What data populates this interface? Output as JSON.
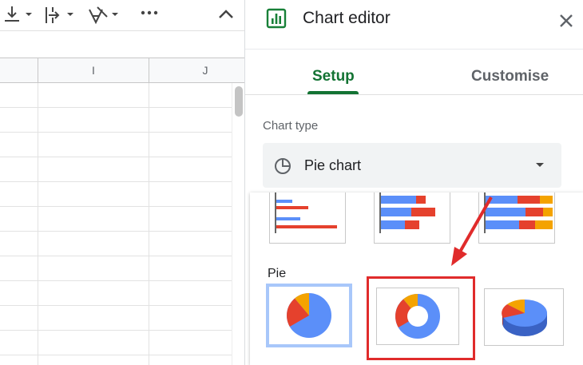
{
  "sheet": {
    "columns": [
      {
        "label": ""
      },
      {
        "label": "I"
      },
      {
        "label": "J"
      }
    ],
    "toolbar_icons": [
      "vertical-align-icon",
      "text-wrap-icon",
      "text-rotation-icon",
      "more-icon",
      "collapse-icon"
    ]
  },
  "editor": {
    "title": "Chart editor",
    "tabs": [
      {
        "label": "Setup",
        "active": true
      },
      {
        "label": "Customise",
        "active": false
      }
    ],
    "chart_type_label": "Chart type",
    "selected_chart_type": "Pie chart",
    "dropdown": {
      "section_title": "Pie",
      "pie_options": [
        {
          "name": "Pie chart",
          "selected": true
        },
        {
          "name": "Doughnut chart",
          "selected": false,
          "highlighted": true
        },
        {
          "name": "3D pie chart",
          "selected": false
        }
      ]
    }
  },
  "colors": {
    "accent_green": "#137333",
    "blue": "#5b8ff9",
    "red": "#e5412d",
    "orange": "#f4a300",
    "highlight_red": "#e02b2b",
    "selected_border": "#a8c7fa"
  }
}
